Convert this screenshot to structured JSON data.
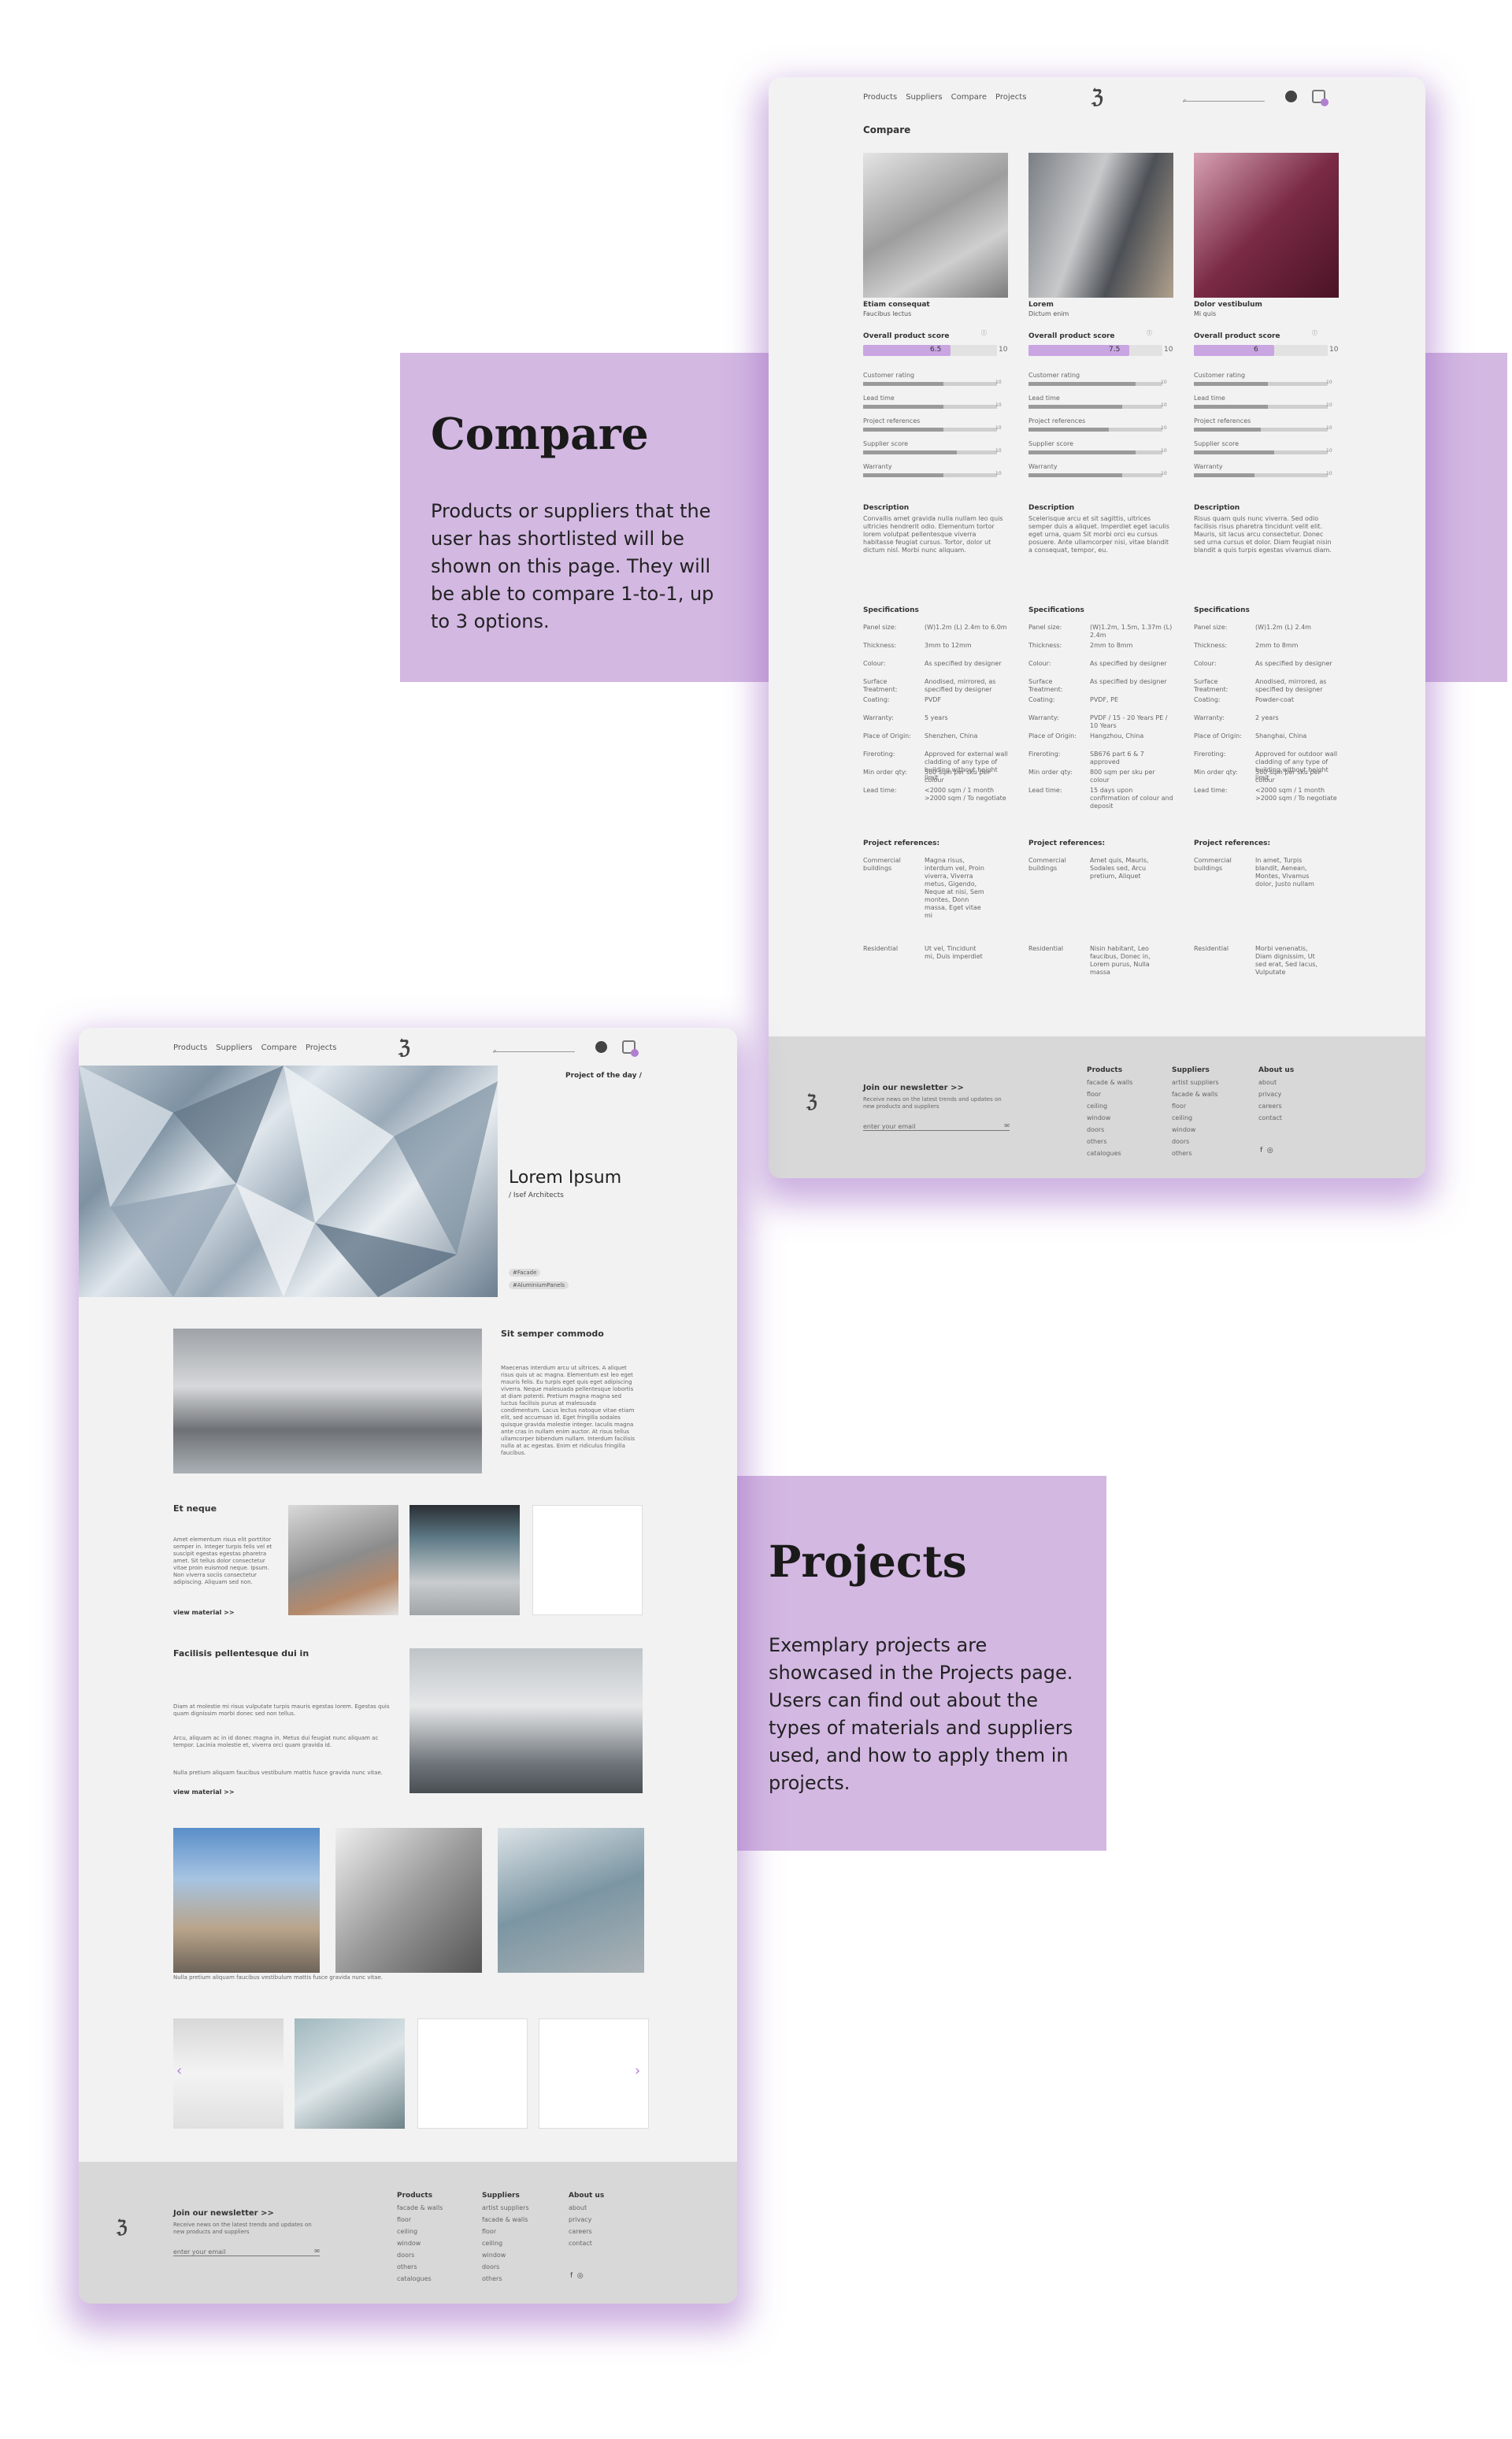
{
  "nav": {
    "products": "Products",
    "suppliers": "Suppliers",
    "compare": "Compare",
    "projects": "Projects",
    "logo": "ℨ"
  },
  "compare_side": {
    "title": "Compare",
    "text": "Products or suppliers that the user has shortlisted will be shown on this page. They will be able to compare 1-to-1, up to 3 options."
  },
  "projects_side": {
    "title": "Projects",
    "text": "Exemplary projects are showcased in the Projects page. Users can find out about the types of materials and suppliers used, and how to apply them in projects."
  },
  "compare_page": {
    "heading": "Compare",
    "overall_label": "Overall product score",
    "ratings": [
      "Customer rating",
      "Lead time",
      "Project references",
      "Supplier score",
      "Warranty"
    ],
    "max": "10",
    "desc_label": "Description",
    "spec_label": "Specifications",
    "proj_label": "Project references:",
    "products": [
      {
        "name": "Etiam consequat",
        "sub": "Faucibus lectus",
        "score": "6.5",
        "score_frac": 0.65,
        "bars": [
          0.6,
          0.6,
          0.6,
          0.7,
          0.6
        ],
        "desc": "Convallis amet gravida nulla nullam leo quis ultricies hendrerit odio. Elementum tortor lorem volutpat pellentesque viverra habitasse feugiat cursus. Tortor, dolor ut dictum nisl. Morbi nunc aliquam.",
        "specs": [
          "(W)1.2m (L) 2.4m to 6.0m",
          "3mm to 12mm",
          "As specified by designer",
          "Anodised, mirrored, as specified by designer",
          "PVDF",
          "5 years",
          "Shenzhen, China",
          "Approved for external wall cladding of any type of building without height limit",
          "500 sqm per sku per colour",
          "<2000 sqm / 1 month >2000 sqm / To negotiate"
        ],
        "refs": [
          {
            "k": "Commercial buildings",
            "v": "Magna risus, interdum vel, Proin viverra, Viverra metus, Gigendo, Neque at nisi, Sem montes, Donn massa, Eget vitae mi"
          },
          {
            "k": "Residential",
            "v": "Ut vel, Tincidunt mi, Duis imperdiet"
          }
        ]
      },
      {
        "name": "Lorem",
        "sub": "Dictum enim",
        "score": "7.5",
        "score_frac": 0.75,
        "bars": [
          0.8,
          0.7,
          0.6,
          0.8,
          0.7
        ],
        "desc": "Scelerisque arcu et sit sagittis, ultrices semper duis a aliquet. Imperdiet eget iaculis eget urna, quam Sit morbi orci eu cursus posuere. Ante ullamcorper nisi, vitae blandit a consequat, tempor, eu.",
        "specs": [
          "(W)1.2m, 1.5m, 1.37m (L) 2.4m",
          "2mm to 8mm",
          "As specified by designer",
          "As specified by designer",
          "PVDF, PE",
          "PVDF / 15 - 20 Years PE / 10 Years",
          "Hangzhou, China",
          "SB676 part 6 & 7 approved",
          "800 sqm per sku per colour",
          "15 days upon confirmation of colour and deposit"
        ],
        "refs": [
          {
            "k": "Commercial buildings",
            "v": "Amet quis, Mauris, Sodales sed, Arcu pretium, Aliquet"
          },
          {
            "k": "Residential",
            "v": "Nisin habitant, Leo faucibus, Donec in, Lorem purus, Nulla massa"
          }
        ]
      },
      {
        "name": "Dolor vestibulum",
        "sub": "Mi quis",
        "score": "6",
        "score_frac": 0.6,
        "bars": [
          0.55,
          0.55,
          0.5,
          0.6,
          0.45
        ],
        "desc": "Risus quam quis nunc viverra. Sed odio facilisis risus pharetra tincidunt velit elit. Mauris, sit lacus arcu consectetur. Donec sed urna cursus et dolor. Diam feugiat nisin blandit a quis turpis egestas vivamus diam.",
        "specs": [
          "(W)1.2m (L) 2.4m",
          "2mm to 8mm",
          "As specified by designer",
          "Anodised, mirrored, as specified by designer",
          "Powder-coat",
          "2 years",
          "Shanghai, China",
          "Approved for outdoor wall cladding of any type of building without height limit",
          "500 sqm per sku per colour",
          "<2000 sqm / 1 month >2000 sqm / To negotiate"
        ],
        "refs": [
          {
            "k": "Commercial buildings",
            "v": "In amet, Turpis blandit, Aenean, Montes, Vivamus dolor, Justo nullam"
          },
          {
            "k": "Residential",
            "v": "Morbi venenatis, Diam dignissim, Ut sed erat, Sed lacus, Vulputate"
          }
        ]
      }
    ],
    "spec_keys": [
      "Panel size:",
      "Thickness:",
      "Colour:",
      "Surface Treatment:",
      "Coating:",
      "Warranty:",
      "Place of Origin:",
      "Fireroting:",
      "Min order qty:",
      "Lead time:"
    ]
  },
  "footer": {
    "newsletter": "Join our newsletter >>",
    "newsletter_sub": "Receive news on the latest trends and updates on new products and suppliers",
    "email_placeholder": "enter your email",
    "products": {
      "title": "Products",
      "items": [
        "facade & walls",
        "floor",
        "ceiling",
        "window",
        "doors",
        "others",
        "catalogues"
      ]
    },
    "suppliers": {
      "title": "Suppliers",
      "items": [
        "artist suppliers",
        "facade & walls",
        "floor",
        "ceiling",
        "window",
        "doors",
        "others"
      ]
    },
    "about": {
      "title": "About us",
      "items": [
        "about",
        "privacy",
        "careers",
        "contact"
      ]
    }
  },
  "projects_page": {
    "potd": "Project of the day /",
    "title": "Lorem Ipsum",
    "sub": "/ Isef Architects",
    "tags": [
      "#Facade",
      "#AluminiumPanels"
    ],
    "s1_title": "Sit semper commodo",
    "s1_text": "Maecenas interdum arcu ut ultrices. A aliquet risus quis ut ac magna. Elementum est leo eget mauris felis. Eu turpis eget quis eget adipiscing viverra. Neque malesuada pellentesque lobortis at diam potenti. Pretium magna magna sed luctus facilisis purus at malesuada condimentum. Lacus lectus natoque vitae etiam elit, sed accumsan id. Eget fringilla sodales quisque gravida molestie integer. Iaculis magna ante cras in nullam enim auctor. At risus tellus ullamcorper bibendum nullam. Interdum facilisis nulla at ac egestas. Enim et ridiculus fringilla faucibus.",
    "s2_title": "Et neque",
    "s2_text": "Amet elementum risus elit porttitor semper in. Integer turpis felis vel et suscipit egestas egestas pharetra amet. Sit tellus dolor consectetur vitae proin euismod neque. Ipsum. Non viverra sociis consectetur adipiscing. Aliquam sed non.",
    "view": "view material >>",
    "s3_title": "Facilisis pellentesque dui in",
    "s3_p1": "Diam at molestie mi risus vulputate turpis mauris egestas lorem. Egestas quis quam dignissim morbi donec sed non tellus.",
    "s3_p2": "Arcu, aliquam ac in id donec magna in. Metus dui feugiat nunc aliquam ac tempor. Lacinia molestie et, viverra orci quam gravida id.",
    "s3_p3": "Nulla pretium aliquam faucibus vestibulum mattis fusce gravida nunc vitae.",
    "caption": "Nulla pretium aliquam faucibus vestibulum mattis fusce gravida nunc vitae.",
    "prev": "‹",
    "next": "›"
  },
  "colors": {
    "accent": "#d3b8e2",
    "purple": "#b17fd0",
    "footer": "#d8d8d8"
  }
}
